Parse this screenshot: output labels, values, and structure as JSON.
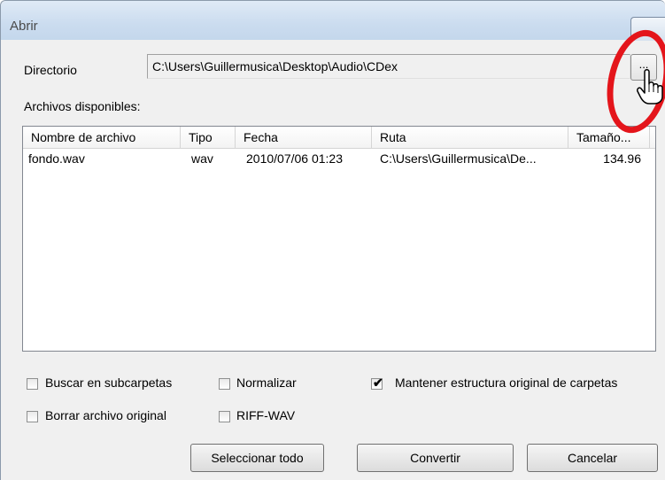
{
  "window": {
    "title": "Abrir"
  },
  "directory": {
    "label": "Directorio",
    "value": "C:\\Users\\Guillermusica\\Desktop\\Audio\\CDex",
    "browse_label": "..."
  },
  "files": {
    "label": "Archivos disponibles:",
    "columns": [
      "Nombre de archivo",
      "Tipo",
      "Fecha",
      "Ruta",
      "Tamaño..."
    ],
    "rows": [
      {
        "name": "fondo.wav",
        "type": "wav",
        "date": "2010/07/06 01:23",
        "path": "C:\\Users\\Guillermusica\\De...",
        "size": "134.96"
      }
    ]
  },
  "options": [
    {
      "label": "Buscar en subcarpetas",
      "checked": false
    },
    {
      "label": "Normalizar",
      "checked": false
    },
    {
      "label": "Mantener estructura original de carpetas",
      "checked": true
    },
    {
      "label": "Borrar archivo original",
      "checked": false
    },
    {
      "label": "RIFF-WAV",
      "checked": false
    }
  ],
  "buttons": {
    "select_all": "Seleccionar todo",
    "convert": "Convertir",
    "cancel": "Cancelar"
  },
  "annotation": {
    "color": "#e4151b",
    "icon": "hand-pointer-icon"
  }
}
